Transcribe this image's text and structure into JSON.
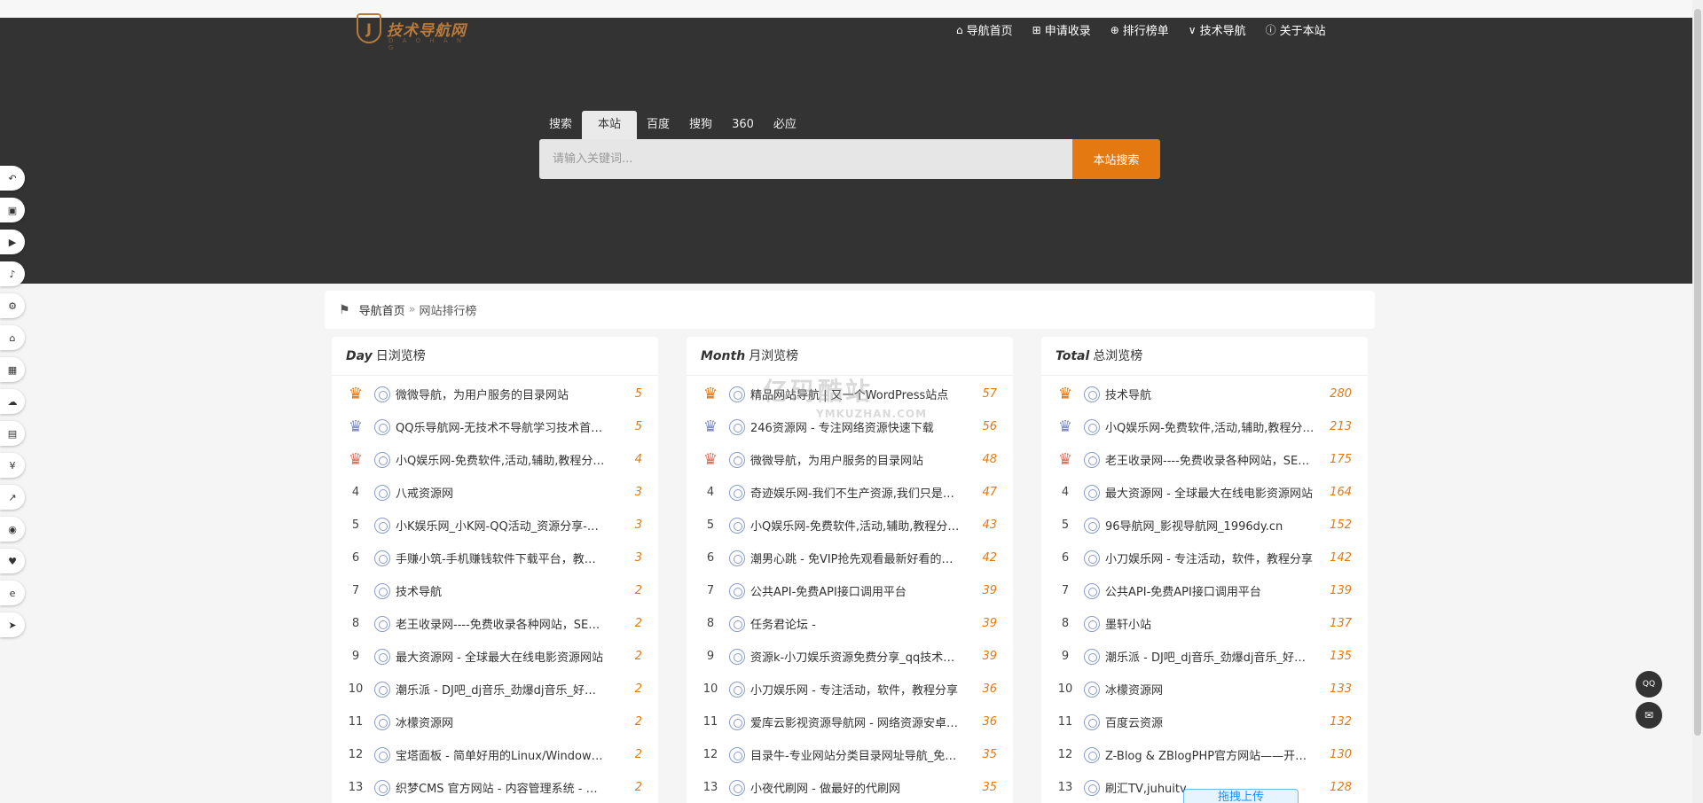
{
  "logo": {
    "text": "技术导航网",
    "sub": "D A O H A N G",
    "mark": "J"
  },
  "nav": [
    {
      "icon": "home-icon",
      "glyph": "⌂",
      "label": "导航首页"
    },
    {
      "icon": "plus-square-icon",
      "glyph": "⊞",
      "label": "申请收录"
    },
    {
      "icon": "ranking-icon",
      "glyph": "⊕",
      "label": "排行榜单"
    },
    {
      "icon": "v-icon",
      "glyph": "∨",
      "label": "技术导航"
    },
    {
      "icon": "info-icon",
      "glyph": "ⓘ",
      "label": "关于本站"
    }
  ],
  "search": {
    "tabs": [
      "搜索",
      "本站",
      "百度",
      "搜狗",
      "360",
      "必应"
    ],
    "active_tab": "本站",
    "placeholder": "请输入关键词...",
    "button": "本站搜索"
  },
  "leftbar": [
    {
      "name": "back-icon",
      "glyph": "↶"
    },
    {
      "name": "store-icon",
      "glyph": "▣"
    },
    {
      "name": "video-icon",
      "glyph": "▶"
    },
    {
      "name": "music-icon",
      "glyph": "♪"
    },
    {
      "name": "games-icon",
      "glyph": "⚙"
    },
    {
      "name": "education-icon",
      "glyph": "⌂"
    },
    {
      "name": "apps-icon",
      "glyph": "▦"
    },
    {
      "name": "cloud-icon",
      "glyph": "☁"
    },
    {
      "name": "document-icon",
      "glyph": "▤"
    },
    {
      "name": "yen-icon",
      "glyph": "¥"
    },
    {
      "name": "chart-icon",
      "glyph": "↗"
    },
    {
      "name": "compass-icon",
      "glyph": "◉"
    },
    {
      "name": "health-icon",
      "glyph": "♥"
    },
    {
      "name": "edge-icon",
      "glyph": "e"
    },
    {
      "name": "send-icon",
      "glyph": "➤"
    }
  ],
  "breadcrumb": {
    "home": "导航首页",
    "sep": "»",
    "current": "网站排行榜"
  },
  "panels": [
    {
      "title_em": "Day",
      "title": "日浏览榜",
      "rows": [
        {
          "rank": "1",
          "site": "微微导航，为用户服务的目录网站",
          "count": "5"
        },
        {
          "rank": "2",
          "site": "QQ乐导航网-无技术不导航学习技术首选导航网",
          "count": "5"
        },
        {
          "rank": "3",
          "site": "小Q娱乐网-免费软件,活动,辅助,教程分享网站",
          "count": "4"
        },
        {
          "rank": "4",
          "site": "八戒资源网",
          "count": "3"
        },
        {
          "rank": "5",
          "site": "小K娱乐网_小K网-QQ活动_资源分享-源码下载",
          "count": "3"
        },
        {
          "rank": "6",
          "site": "手赚小筑-手机赚钱软件下载平台，教你赚钱",
          "count": "3"
        },
        {
          "rank": "7",
          "site": "技术导航",
          "count": "2"
        },
        {
          "rank": "8",
          "site": "老王收录网----免费收录各种网站，SEO优化",
          "count": "2"
        },
        {
          "rank": "9",
          "site": "最大资源网 - 全球最大在线电影资源网站",
          "count": "2"
        },
        {
          "rank": "10",
          "site": "潮乐派 - DJ吧_dj音乐_劲爆dj音乐_好听的歌",
          "count": "2"
        },
        {
          "rank": "11",
          "site": "冰檬资源网",
          "count": "2"
        },
        {
          "rank": "12",
          "site": "宝塔面板 - 简单好用的Linux/Windows服务器",
          "count": "2"
        },
        {
          "rank": "13",
          "site": "织梦CMS 官方网站 - 内容管理系统 - 上海卓卓",
          "count": "2"
        }
      ]
    },
    {
      "title_em": "Month",
      "title": "月浏览榜",
      "rows": [
        {
          "rank": "1",
          "site": "精品网站导航 | 又一个WordPress站点",
          "count": "57"
        },
        {
          "rank": "2",
          "site": "246资源网 - 专注网络资源快速下载",
          "count": "56"
        },
        {
          "rank": "3",
          "site": "微微导航，为用户服务的目录网站",
          "count": "48"
        },
        {
          "rank": "4",
          "site": "奇迹娱乐网-我们不生产资源,我们只是资源的搬运工",
          "count": "47"
        },
        {
          "rank": "5",
          "site": "小Q娱乐网-免费软件,活动,辅助,教程分享网站",
          "count": "43"
        },
        {
          "rank": "6",
          "site": "潮男心跳 - 免VIP抢先观看最新好看的电影",
          "count": "42"
        },
        {
          "rank": "7",
          "site": "公共API-免费API接口调用平台",
          "count": "39"
        },
        {
          "rank": "8",
          "site": "任务君论坛 -",
          "count": "39"
        },
        {
          "rank": "9",
          "site": "资源k-小刀娱乐资源免费分享_qq技术网站",
          "count": "39"
        },
        {
          "rank": "10",
          "site": "小刀娱乐网 - 专注活动，软件，教程分享",
          "count": "36"
        },
        {
          "rank": "11",
          "site": "爱库云影视资源导航网 - 网络资源安卓软件",
          "count": "36"
        },
        {
          "rank": "12",
          "site": "目录牛-专业网站分类目录网址导航_免费收录",
          "count": "35"
        },
        {
          "rank": "13",
          "site": "小夜代刷网 - 做最好的代刷网",
          "count": "35"
        }
      ]
    },
    {
      "title_em": "Total",
      "title": "总浏览榜",
      "rows": [
        {
          "rank": "1",
          "site": "技术导航",
          "count": "280"
        },
        {
          "rank": "2",
          "site": "小Q娱乐网-免费软件,活动,辅助,教程分享网站",
          "count": "213"
        },
        {
          "rank": "3",
          "site": "老王收录网----免费收录各种网站，SEO优化",
          "count": "175"
        },
        {
          "rank": "4",
          "site": "最大资源网 - 全球最大在线电影资源网站",
          "count": "164"
        },
        {
          "rank": "5",
          "site": "96导航网_影视导航网_1996dy.cn",
          "count": "152"
        },
        {
          "rank": "6",
          "site": "小刀娱乐网 - 专注活动，软件，教程分享",
          "count": "142"
        },
        {
          "rank": "7",
          "site": "公共API-免费API接口调用平台",
          "count": "139"
        },
        {
          "rank": "8",
          "site": "墨轩小站",
          "count": "137"
        },
        {
          "rank": "9",
          "site": "潮乐派 - DJ吧_dj音乐_劲爆dj音乐_好听的歌",
          "count": "135"
        },
        {
          "rank": "10",
          "site": "冰檬资源网",
          "count": "133"
        },
        {
          "rank": "11",
          "site": "百度云资源",
          "count": "132"
        },
        {
          "rank": "12",
          "site": "Z-Blog & ZBlogPHP官方网站——开源免费的博客",
          "count": "130"
        },
        {
          "rank": "13",
          "site": "刷汇TV,juhuitv",
          "count": "128"
        }
      ]
    }
  ],
  "watermark": {
    "text": "亿码酷站",
    "sub": "YMKUZHAN.COM"
  },
  "floating": {
    "qq": "QQ",
    "mail": "✉",
    "upload": "拖拽上传"
  }
}
